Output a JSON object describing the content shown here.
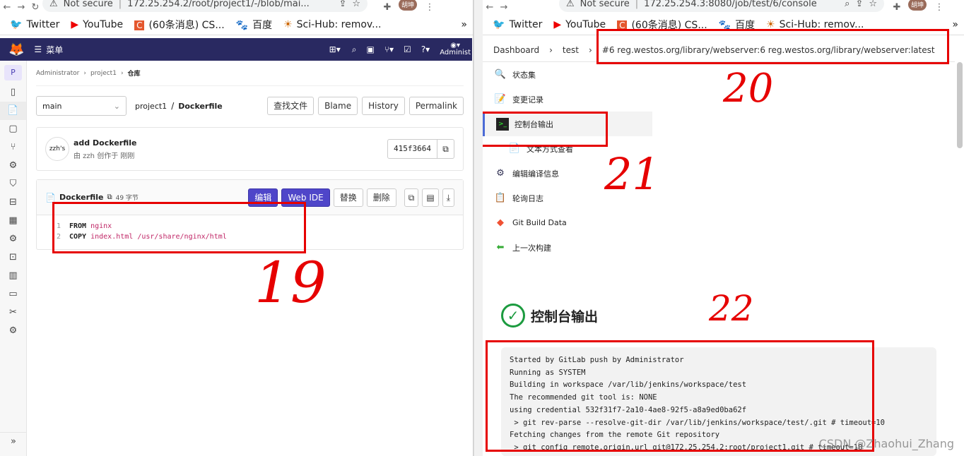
{
  "left": {
    "url_security": "Not secure",
    "url": "172.25.254.2/root/project1/-/blob/mai...",
    "avatar_text": "胡坤",
    "bookmarks": [
      "Twitter",
      "YouTube",
      "(60条消息) CS...",
      "百度",
      "Sci-Hub: remov..."
    ],
    "nav": {
      "menu_label": "菜单",
      "admin_label": "Administ"
    },
    "breadcrumb": [
      "Administrator",
      "project1",
      "仓库"
    ],
    "branch": "main",
    "path": {
      "project": "project1",
      "sep": "/",
      "file": "Dockerfile"
    },
    "buttons": {
      "find": "查找文件",
      "blame": "Blame",
      "history": "History",
      "permalink": "Permalink"
    },
    "commit": {
      "avatar_alt": "zzh's",
      "message": "add Dockerfile",
      "meta": "由 zzh 创作于 刚刚",
      "sha": "415f3664"
    },
    "file": {
      "name": "Dockerfile",
      "size": "49 字节",
      "edit": "编辑",
      "webide": "Web IDE",
      "replace": "替换",
      "delete": "删除"
    },
    "code": [
      {
        "num": "1",
        "kw": "FROM",
        "arg": "nginx"
      },
      {
        "num": "2",
        "kw": "COPY",
        "arg": "index.html /usr/share/nginx/html"
      }
    ],
    "annotation": "19"
  },
  "right": {
    "url_security": "Not secure",
    "url": "172.25.254.3:8080/job/test/6/console",
    "avatar_text": "胡坤",
    "bookmarks": [
      "Twitter",
      "YouTube",
      "(60条消息) CS...",
      "百度",
      "Sci-Hub: remov..."
    ],
    "breadcrumb": {
      "dashboard": "Dashboard",
      "job": "test",
      "build": "#6 reg.westos.org/library/webserver:6 reg.westos.org/library/webserver:latest"
    },
    "menu": [
      "状态集",
      "变更记录",
      "控制台输出",
      "文本方式查看",
      "编辑编译信息",
      "轮询日志",
      "Git Build Data",
      "上一次构建"
    ],
    "console_title": "控制台输出",
    "console_lines": [
      "Started by GitLab push by Administrator",
      "Running as SYSTEM",
      "Building in workspace /var/lib/jenkins/workspace/test",
      "The recommended git tool is: NONE",
      "using credential 532f31f7-2a10-4ae8-92f5-a8a9ed0ba62f",
      " > git rev-parse --resolve-git-dir /var/lib/jenkins/workspace/test/.git # timeout=10",
      "Fetching changes from the remote Git repository",
      " > git config remote.origin.url git@172.25.254.2:root/project1.git # timeout=10"
    ],
    "annotations": [
      "20",
      "21",
      "22"
    ],
    "watermark": "CSDN @Zhaohui_Zhang"
  }
}
